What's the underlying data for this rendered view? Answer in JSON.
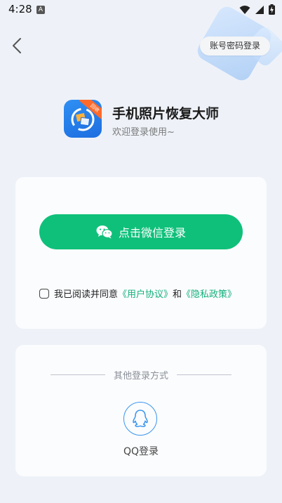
{
  "status_bar": {
    "time": "4:28",
    "notification_glyph": "A",
    "icons": [
      "wifi-icon",
      "signal-icon",
      "battery-charging-icon"
    ]
  },
  "header": {
    "back_icon": "chevron-left-icon",
    "account_login_label": "账号密码登录"
  },
  "app": {
    "title": "手机照片恢复大师",
    "subtitle": "欢迎登录使用~",
    "badge": "回收"
  },
  "login": {
    "wechat_button_label": "点击微信登录",
    "agreement_prefix": "我已阅读并同意",
    "user_agreement": "《用户协议》",
    "and_text": "和",
    "privacy_policy": "《隐私政策》",
    "agreement_checked": false
  },
  "other_login": {
    "heading": "其他登录方式",
    "qq_label": "QQ登录"
  },
  "colors": {
    "wechat_green": "#0fc07a",
    "link_green": "#12b07a",
    "qq_blue": "#3a95ee",
    "background": "#eef2f8"
  }
}
